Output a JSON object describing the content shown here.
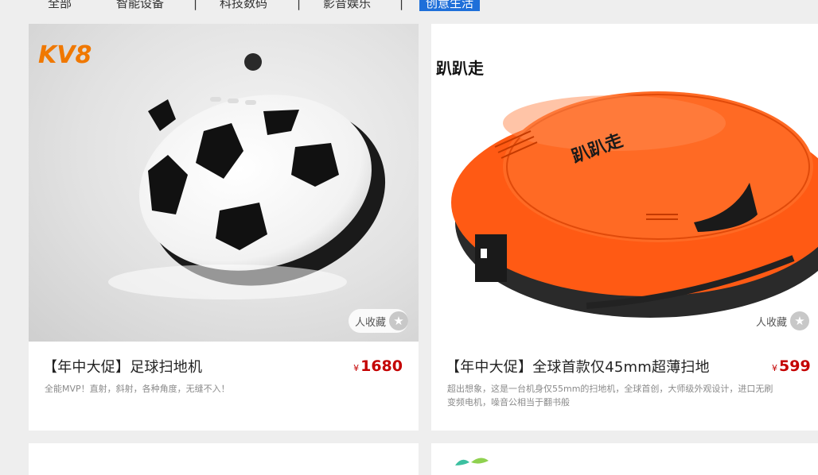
{
  "nav": {
    "items": [
      {
        "label": "全部"
      },
      {
        "label": "智能设备"
      },
      {
        "label": "科技数码"
      },
      {
        "label": "影音娱乐"
      },
      {
        "label": "创意生活"
      }
    ],
    "separator": "|",
    "active_index": 4
  },
  "products": [
    {
      "brand_logo": "KV8",
      "title": "【年中大促】足球扫地机",
      "currency": "¥",
      "price": "1680",
      "description": "全能MVP！直射，斜射，各种角度，无缝不入！",
      "favorite_label": "人收藏",
      "image_icon": "soccer-ball-robot-vacuum"
    },
    {
      "brand_logo": "趴趴走",
      "title": "【年中大促】全球首款仅45mm超薄扫地",
      "currency": "¥",
      "price": "599",
      "description_lines": [
        "超出想象，这是一台机身仅55mm的扫地机，全球首创，大师级外观设计，进口无刷",
        "变频电机，噪音公相当于翻书般"
      ],
      "favorite_label": "人收藏",
      "image_icon": "orange-robot-vacuum"
    }
  ],
  "colors": {
    "accent": "#1e6fd9",
    "price": "#c40000",
    "orange_body": "#ff5a14"
  }
}
